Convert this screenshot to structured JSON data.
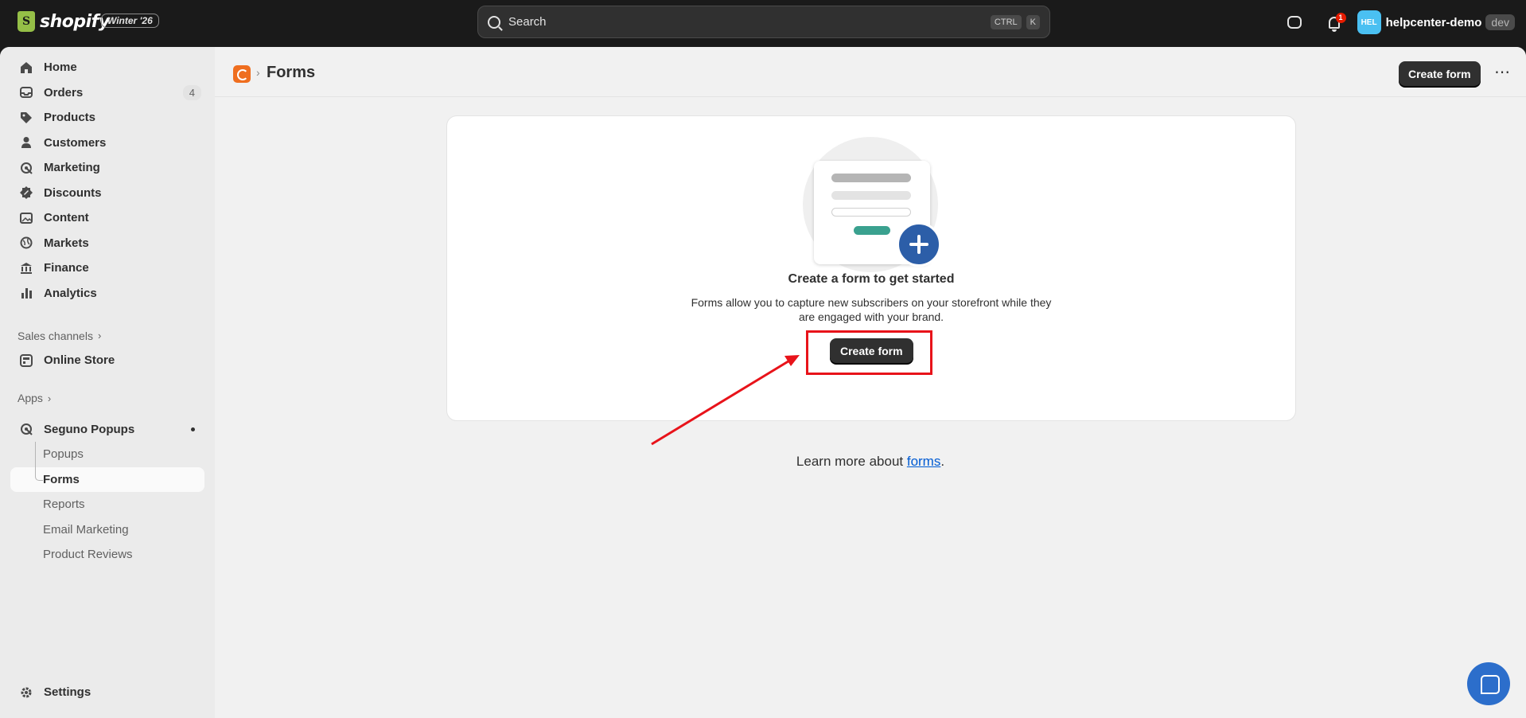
{
  "topbar": {
    "logo_text": "shopify",
    "version_badge": "Winter '26",
    "search_placeholder": "Search",
    "shortcut_keys": [
      "CTRL",
      "K"
    ],
    "notification_count": "1",
    "store_avatar": "HEL",
    "store_name": "helpcenter-demo",
    "store_tag": "dev"
  },
  "sidebar": {
    "items": [
      {
        "label": "Home",
        "icon": "home-icon"
      },
      {
        "label": "Orders",
        "icon": "inbox-icon",
        "count": "4"
      },
      {
        "label": "Products",
        "icon": "tag-icon"
      },
      {
        "label": "Customers",
        "icon": "person-icon"
      },
      {
        "label": "Marketing",
        "icon": "target-icon"
      },
      {
        "label": "Discounts",
        "icon": "discount-icon"
      },
      {
        "label": "Content",
        "icon": "image-icon"
      },
      {
        "label": "Markets",
        "icon": "globe-icon"
      },
      {
        "label": "Finance",
        "icon": "bank-icon"
      },
      {
        "label": "Analytics",
        "icon": "bar-chart-icon"
      }
    ],
    "sales_channels_label": "Sales channels",
    "online_store_label": "Online Store",
    "apps_label": "Apps",
    "app_name": "Seguno Popups",
    "app_subitems": [
      "Popups",
      "Forms",
      "Reports",
      "Email Marketing",
      "Product Reviews"
    ],
    "settings_label": "Settings"
  },
  "header": {
    "title": "Forms",
    "create_button": "Create form"
  },
  "empty_state": {
    "title": "Create a form to get started",
    "body": "Forms allow you to capture new subscribers on your storefront while they are engaged with your brand.",
    "create_button": "Create form"
  },
  "learn_more": {
    "prefix": "Learn more about ",
    "link": "forms",
    "suffix": "."
  },
  "colors": {
    "primary_button": "#303030",
    "highlight": "#e8131a",
    "link": "#005bd3",
    "fab": "#2c5ea8"
  }
}
